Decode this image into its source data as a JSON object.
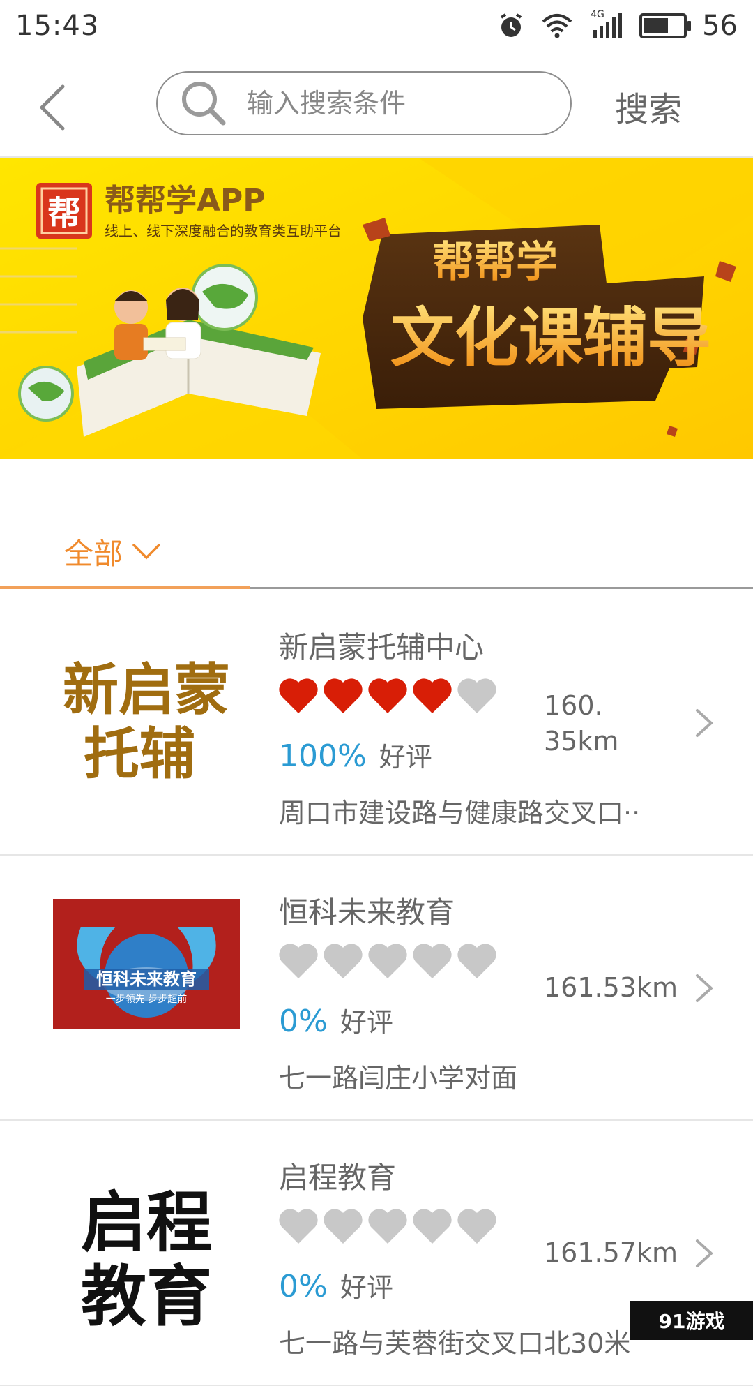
{
  "status_bar": {
    "time": "15:43",
    "network": "4G",
    "battery": "56"
  },
  "search": {
    "placeholder": "输入搜索条件",
    "button_label": "搜索"
  },
  "banner": {
    "brand": "帮帮学APP",
    "brand_logo_char": "帮",
    "tagline": "线上、线下深度融合的教育类互助平台",
    "heading": "帮帮学",
    "subheading": "文化课辅导"
  },
  "filter": {
    "label": "全部"
  },
  "items": [
    {
      "logo_lines": [
        "新启蒙",
        "托辅"
      ],
      "name": "新启蒙托辅中心",
      "rating": 4,
      "rating_pct": "100%",
      "rating_label": "好评",
      "distance_lines": [
        "160.",
        "35km"
      ],
      "address": "周口市建设路与健康路交叉口··"
    },
    {
      "logo_text": "恒科未来教育",
      "logo_slogan": "一步领先 步步超前",
      "name": "恒科未来教育",
      "rating": 0,
      "rating_pct": "0%",
      "rating_label": "好评",
      "distance": "161.53km",
      "address": "七一路闫庄小学对面"
    },
    {
      "logo_lines": [
        "启程",
        "教育"
      ],
      "name": "启程教育",
      "rating": 0,
      "rating_pct": "0%",
      "rating_label": "好评",
      "distance": "161.57km",
      "address": "七一路与芙蓉街交叉口北30米"
    }
  ],
  "watermark": "91游戏",
  "colors": {
    "accent": "#f08a2c",
    "rating_blue": "#2b9bd3",
    "heart_red": "#d81e06",
    "heart_gray": "#c8c8c8",
    "banner_yellow": "#ffdf00"
  }
}
